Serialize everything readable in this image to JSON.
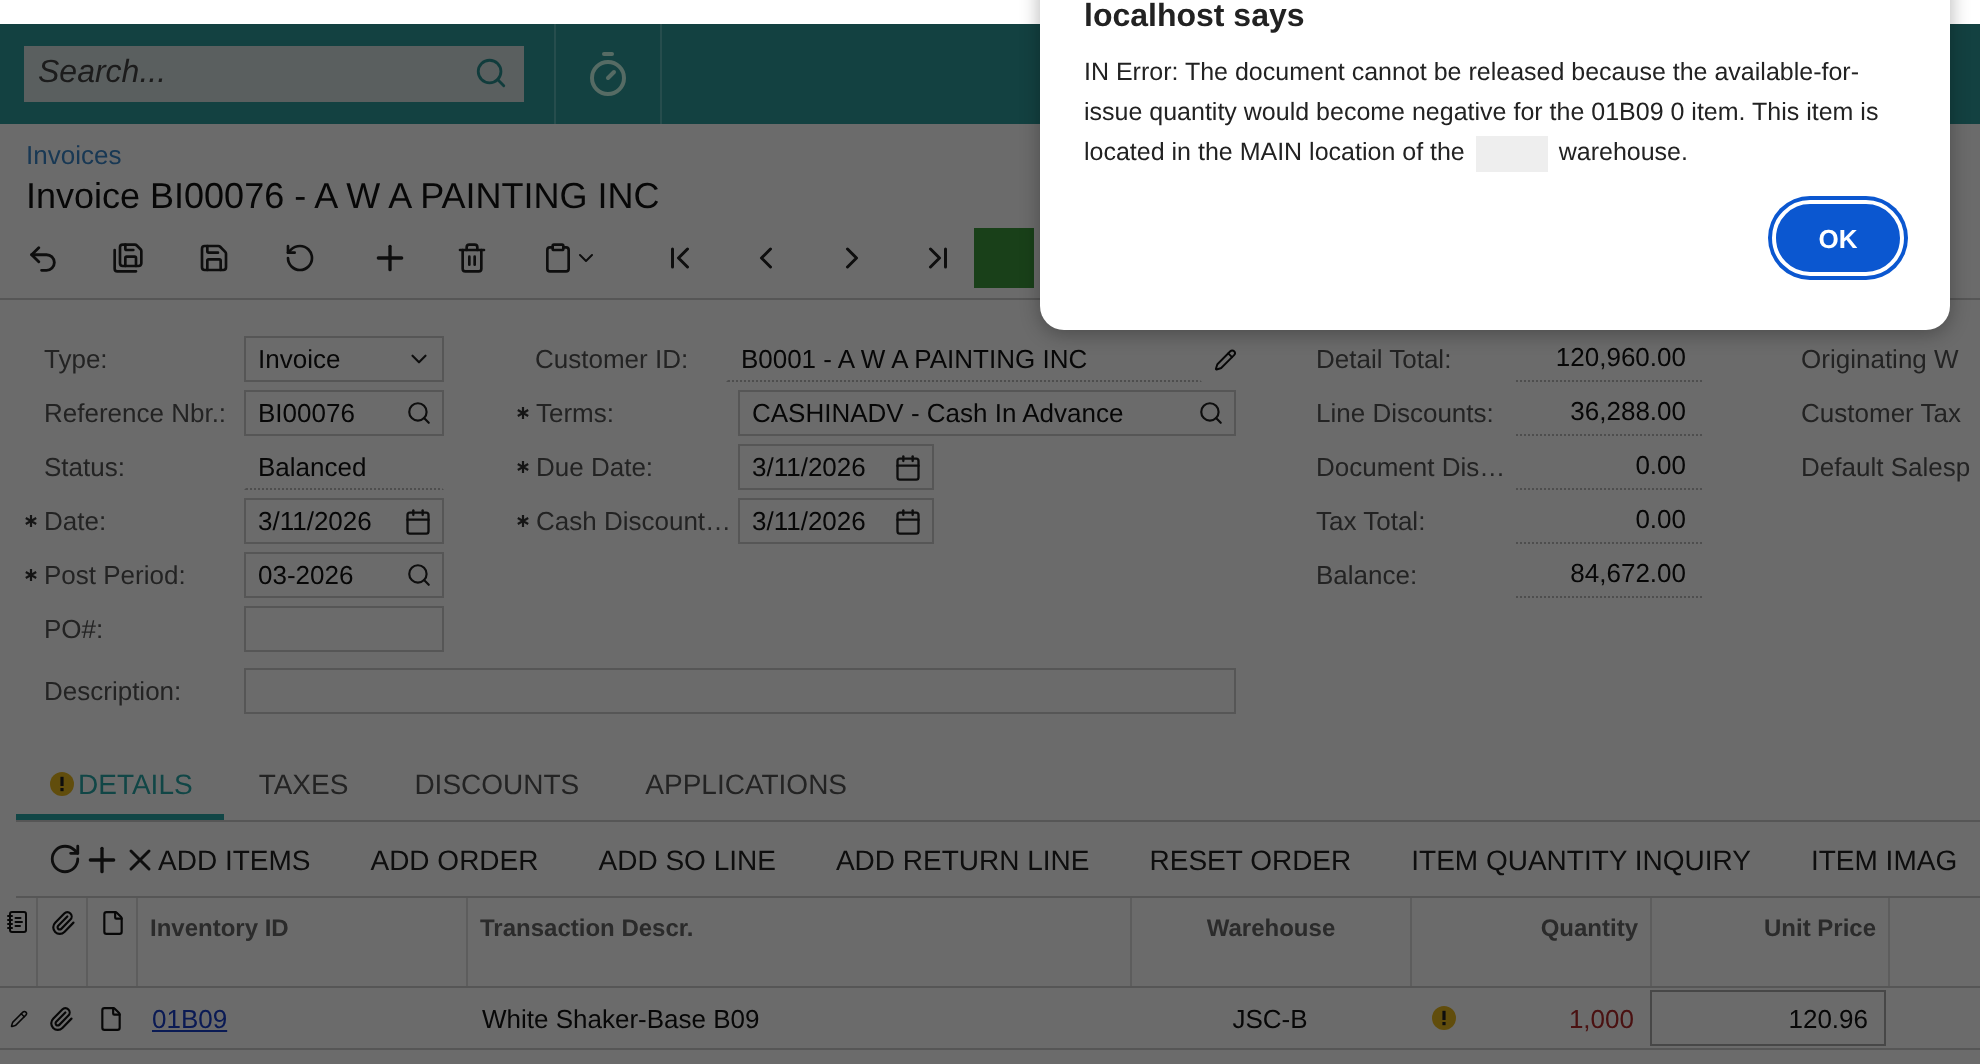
{
  "search": {
    "placeholder": "Search..."
  },
  "breadcrumb": "Invoices",
  "title": "Invoice BI00076 - A W A PAINTING INC",
  "summary_left": [
    {
      "label": "Type:",
      "value": "Invoice",
      "kind": "select",
      "required": false
    },
    {
      "label": "Reference Nbr.:",
      "value": "BI00076",
      "kind": "lookup",
      "required": false
    },
    {
      "label": "Status:",
      "value": "Balanced",
      "kind": "static",
      "required": false
    },
    {
      "label": "Date:",
      "value": "3/11/2026",
      "kind": "date",
      "required": true
    },
    {
      "label": "Post Period:",
      "value": "03-2026",
      "kind": "lookup",
      "required": true
    },
    {
      "label": "PO#:",
      "kind": "text",
      "required": false
    }
  ],
  "summary_middle": [
    {
      "label": "Customer ID:",
      "value": "B0001 - A W A PAINTING INC",
      "kind": "static",
      "required": false
    },
    {
      "label": "Terms:",
      "value": "CASHINADV - Cash In Advance",
      "kind": "lookup",
      "required": true
    },
    {
      "label": "Due Date:",
      "value": "3/11/2026",
      "kind": "date",
      "required": true
    },
    {
      "label": "Cash Discount…",
      "value": "3/11/2026",
      "kind": "date",
      "required": true
    }
  ],
  "description": {
    "label": "Description:"
  },
  "totals": [
    {
      "label": "Detail Total:",
      "value": "120,960.00"
    },
    {
      "label": "Line Discounts:",
      "value": "36,288.00"
    },
    {
      "label": "Document Dis…",
      "value": "0.00"
    },
    {
      "label": "Tax Total:",
      "value": "0.00"
    },
    {
      "label": "Balance:",
      "value": "84,672.00"
    }
  ],
  "summary_right": [
    "Originating W",
    "Customer Tax",
    "Default Salesp"
  ],
  "tabs": [
    {
      "label": "DETAILS",
      "selected": true,
      "warning": true
    },
    {
      "label": "TAXES",
      "selected": false,
      "warning": false
    },
    {
      "label": "DISCOUNTS",
      "selected": false,
      "warning": false
    },
    {
      "label": "APPLICATIONS",
      "selected": false,
      "warning": false
    }
  ],
  "grid_actions": [
    "ADD ITEMS",
    "ADD ORDER",
    "ADD SO LINE",
    "ADD RETURN LINE",
    "RESET ORDER",
    "ITEM QUANTITY INQUIRY",
    "ITEM IMAG"
  ],
  "table": {
    "columns": [
      "Inventory ID",
      "Transaction Descr.",
      "Warehouse",
      "Quantity",
      "Unit Price"
    ],
    "rows": [
      {
        "inventory_id": "01B09",
        "description": "White Shaker-Base B09",
        "warehouse": "JSC-B",
        "quantity_warning": true,
        "quantity": "1,000",
        "unit_price": "120.96"
      }
    ]
  },
  "dialog": {
    "title": "localhost says",
    "message_before": "IN Error: The document cannot be released because the available-for-issue quantity would become negative for the 01B09 0 item. This item is located in the MAIN location of the",
    "message_after": "warehouse.",
    "button": "OK"
  }
}
